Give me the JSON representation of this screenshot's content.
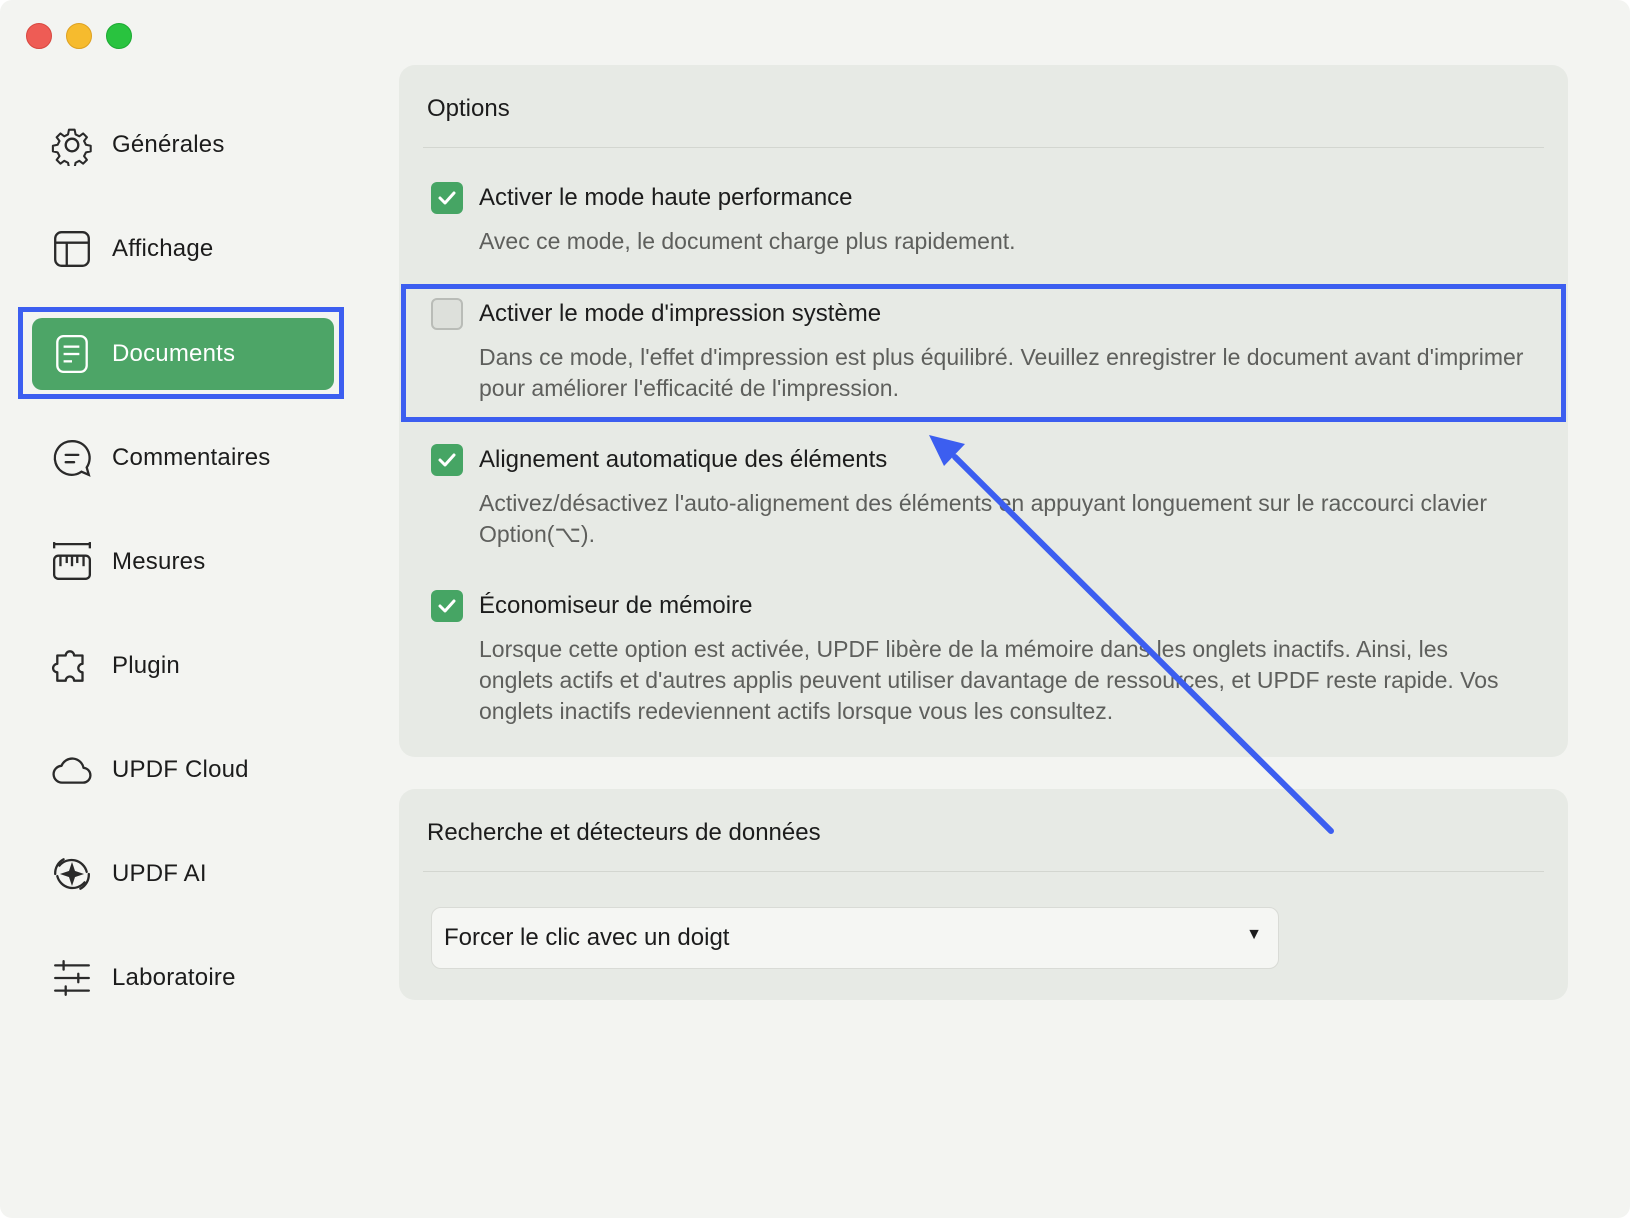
{
  "window": {
    "controls": [
      "close",
      "minimize",
      "zoom"
    ]
  },
  "sidebar": {
    "items": [
      {
        "label": "Générales",
        "icon": "gear-icon"
      },
      {
        "label": "Affichage",
        "icon": "layout-icon"
      },
      {
        "label": "Documents",
        "icon": "document-icon",
        "active": true
      },
      {
        "label": "Commentaires",
        "icon": "comment-icon"
      },
      {
        "label": "Mesures",
        "icon": "ruler-icon"
      },
      {
        "label": "Plugin",
        "icon": "puzzle-icon"
      },
      {
        "label": "UPDF Cloud",
        "icon": "cloud-icon"
      },
      {
        "label": "UPDF AI",
        "icon": "ai-sparkle-icon"
      },
      {
        "label": "Laboratoire",
        "icon": "sliders-icon"
      }
    ]
  },
  "options": {
    "title": "Options",
    "items": [
      {
        "title": "Activer le mode haute performance",
        "description": "Avec ce mode, le document charge plus rapidement.",
        "checked": true
      },
      {
        "title": "Activer le mode d'impression système",
        "description": "Dans ce mode, l'effet d'impression est plus équilibré. Veuillez enregistrer le document avant d'imprimer pour améliorer l'efficacité de l'impression.",
        "checked": false
      },
      {
        "title": "Alignement automatique des éléments",
        "description": "Activez/désactivez l'auto-alignement des éléments en appuyant longuement sur le raccourci clavier Option(⌥).",
        "checked": true
      },
      {
        "title": "Économiseur de mémoire",
        "description": "Lorsque cette option est activée, UPDF libère de la mémoire dans les onglets inactifs. Ainsi, les onglets actifs et d'autres applis peuvent utiliser davantage de ressources, et UPDF reste rapide. Vos onglets inactifs redeviennent actifs lorsque vous les consultez.",
        "checked": true
      }
    ]
  },
  "search": {
    "title": "Recherche et détecteurs de données",
    "dropdown_value": "Forcer le clic avec un doigt"
  },
  "colors": {
    "accent": "#4da567",
    "highlight": "#3c5ef0"
  }
}
